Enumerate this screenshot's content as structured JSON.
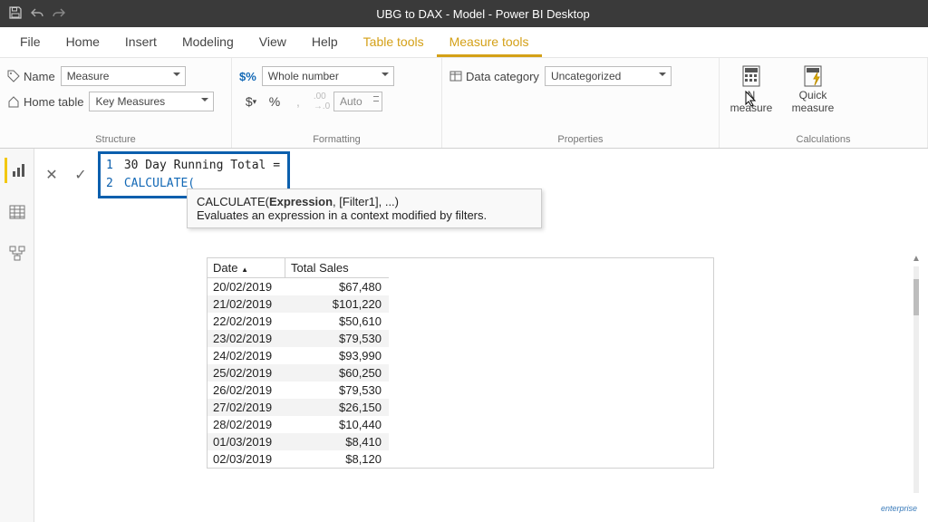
{
  "titlebar": {
    "title": "UBG to DAX - Model - Power BI Desktop"
  },
  "tabs": [
    "File",
    "Home",
    "Insert",
    "Modeling",
    "View",
    "Help",
    "Table tools",
    "Measure tools"
  ],
  "ribbon": {
    "structure": {
      "label": "Structure",
      "name_label": "Name",
      "name_value": "Measure",
      "home_label": "Home table",
      "home_value": "Key Measures"
    },
    "formatting": {
      "label": "Formatting",
      "format_value": "Whole number",
      "decimals": "Auto"
    },
    "properties": {
      "label": "Properties",
      "category_label": "Data category",
      "category_value": "Uncategorized"
    },
    "calculations": {
      "label": "Calculations",
      "new_measure_line1": "N",
      "new_measure_line2": "measure",
      "quick_line1": "Quick",
      "quick_line2": "measure"
    }
  },
  "formula": {
    "line1": "30 Day Running Total =",
    "line2": "CALCULATE("
  },
  "tooltip": {
    "signature": "CALCULATE(",
    "arg_bold": "Expression",
    "rest": ", [Filter1], ...)",
    "desc": "Evaluates an expression in a context modified by filters."
  },
  "table": {
    "columns": [
      "Date",
      "Total Sales"
    ],
    "rows": [
      [
        "20/02/2019",
        "$67,480"
      ],
      [
        "21/02/2019",
        "$101,220"
      ],
      [
        "22/02/2019",
        "$50,610"
      ],
      [
        "23/02/2019",
        "$79,530"
      ],
      [
        "24/02/2019",
        "$93,990"
      ],
      [
        "25/02/2019",
        "$60,250"
      ],
      [
        "26/02/2019",
        "$79,530"
      ],
      [
        "27/02/2019",
        "$26,150"
      ],
      [
        "28/02/2019",
        "$10,440"
      ],
      [
        "01/03/2019",
        "$8,410"
      ],
      [
        "02/03/2019",
        "$8,120"
      ]
    ]
  },
  "watermark": "enterprise"
}
